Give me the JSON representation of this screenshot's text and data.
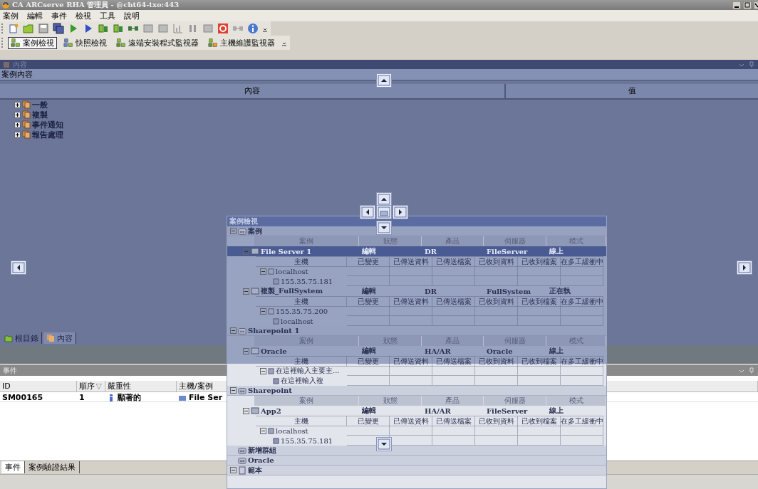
{
  "window": {
    "title": "CA ARCserve RHA 管理員 - @cht64-txo:443"
  },
  "menu": [
    "案例",
    "編輯",
    "事件",
    "檢視",
    "工具",
    "說明"
  ],
  "view_bar": [
    {
      "label": "案例檢視",
      "selected": true
    },
    {
      "label": "快照檢視",
      "selected": false
    },
    {
      "label": "遠端安裝程式監視器",
      "selected": false
    },
    {
      "label": "主機維護監視器",
      "selected": false
    }
  ],
  "content_panel": {
    "title": "內容",
    "subtitle": "案例內容",
    "columns": [
      "內容",
      "值"
    ],
    "items": [
      {
        "label": "一般",
        "expanded": false
      },
      {
        "label": "複製",
        "expanded": false
      },
      {
        "label": "事件通知",
        "expanded": false
      },
      {
        "label": "報告處理",
        "expanded": false
      }
    ]
  },
  "left_tabs": [
    {
      "label": "根目錄",
      "selected": false
    },
    {
      "label": "內容",
      "selected": true
    }
  ],
  "events_panel": {
    "title": "事件",
    "columns": [
      {
        "label": "ID"
      },
      {
        "label": "順序",
        "sort_mark": "▽"
      },
      {
        "label": "嚴重性"
      },
      {
        "label": "主機/案例"
      }
    ],
    "rows": [
      {
        "id": "SM00165",
        "order": "1",
        "severity": "顯著的",
        "host": "File Ser"
      }
    ]
  },
  "bottom_tabs": [
    {
      "label": "事件",
      "selected": true
    },
    {
      "label": "案例驗證結果",
      "selected": false
    }
  ],
  "scenario_view": {
    "title": "案例檢視",
    "groups": [
      {
        "name": "案例",
        "expanded": true,
        "columns": [
          "案例",
          "狀態",
          "產品",
          "伺服器",
          "模式"
        ],
        "scenarios": [
          {
            "name": "File Server 1",
            "state": "編輯",
            "product": "DR",
            "server": "FileServer",
            "mode": "線上",
            "selected": true,
            "host_columns": [
              "主機",
              "已變更",
              "已傳送資料",
              "已傳送檔案",
              "已收到資料",
              "已收到檔案",
              "在多工緩衝中"
            ],
            "hosts": [
              {
                "name": "localhost",
                "expanded": true,
                "children": [
                  {
                    "name": "155.35.75.181"
                  }
                ]
              }
            ]
          },
          {
            "name": "複製_FullSystem",
            "state": "編輯",
            "product": "DR",
            "server": "FullSystem",
            "mode": "正在執",
            "selected": false,
            "host_columns": [
              "主機",
              "已變更",
              "已傳送資料",
              "已傳送檔案",
              "已收到資料",
              "已收到檔案",
              "在多工緩衝中"
            ],
            "hosts": [
              {
                "name": "155.35.75.200",
                "expanded": true,
                "children": [
                  {
                    "name": "localhost"
                  }
                ]
              }
            ]
          }
        ]
      },
      {
        "name": "Sharepoint 1",
        "expanded": true,
        "columns": [
          "案例",
          "狀態",
          "產品",
          "伺服器",
          "模式"
        ],
        "scenarios": [
          {
            "name": "Oracle",
            "state": "編輯",
            "product": "HA/AR",
            "server": "Oracle",
            "mode": "線上",
            "selected": false,
            "host_columns": [
              "主機",
              "已變更",
              "已傳送資料",
              "已傳送檔案",
              "已收到資料",
              "已收到檔案",
              "在多工緩衝中"
            ],
            "hosts": [
              {
                "name": "在這裡輸入主要主...",
                "expanded": true,
                "children": [
                  {
                    "name": "在這裡輸入複"
                  }
                ]
              }
            ]
          }
        ]
      },
      {
        "name": "Sharepoint",
        "expanded": true,
        "columns": [
          "案例",
          "狀態",
          "產品",
          "伺服器",
          "模式"
        ],
        "scenarios": [
          {
            "name": "App2",
            "state": "編輯",
            "product": "HA/AR",
            "server": "FileServer",
            "mode": "線上",
            "selected": false,
            "host_columns": [
              "主機",
              "已變更",
              "已傳送資料",
              "已傳送檔案",
              "已收到資料",
              "已收到檔案",
              "在多工緩衝中"
            ],
            "hosts": [
              {
                "name": "localhost",
                "expanded": true,
                "children": [
                  {
                    "name": "155.35.75.181"
                  }
                ]
              }
            ]
          }
        ]
      },
      {
        "name": "新增群組",
        "expanded": false
      },
      {
        "name": "Oracle",
        "expanded": false
      }
    ],
    "templates": {
      "label": "範本",
      "expanded": true
    }
  }
}
